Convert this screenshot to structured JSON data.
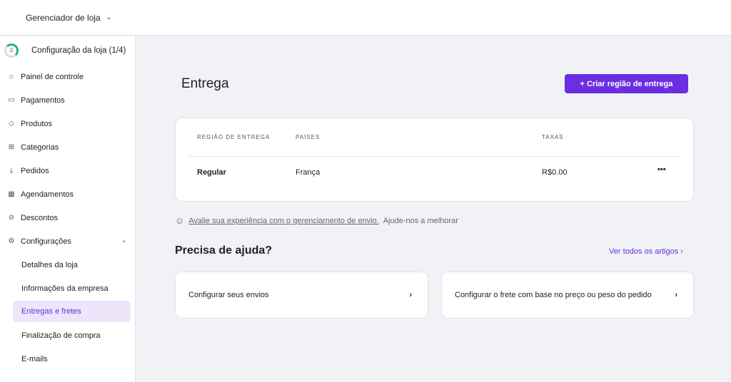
{
  "header": {
    "store_label": "Gerenciador de loja"
  },
  "sidebar": {
    "setup": "Configuração da loja (1/4)",
    "items": [
      {
        "label": "Painel de controle",
        "icon": "⌂"
      },
      {
        "label": "Pagamentos",
        "icon": "▭"
      },
      {
        "label": "Produtos",
        "icon": "◇"
      },
      {
        "label": "Categorias",
        "icon": "⊞"
      },
      {
        "label": "Pedidos",
        "icon": "⤓"
      },
      {
        "label": "Agendamentos",
        "icon": "▦"
      },
      {
        "label": "Descontos",
        "icon": "⊘"
      },
      {
        "label": "Configurações",
        "icon": "⚙"
      }
    ],
    "subitems": [
      "Detalhes da loja",
      "Informações da empresa",
      "Entregas e fretes",
      "Finalização de compra",
      "E-mails"
    ]
  },
  "main": {
    "title": "Entrega",
    "create_button": "+ Criar região de entrega",
    "table": {
      "headers": [
        "REGIÃO DE ENTREGA",
        "PAÍSES",
        "TAXAS"
      ],
      "rows": [
        {
          "region": "Regular",
          "countries": "França",
          "fees": "R$0.00"
        }
      ]
    },
    "feedback_link": "Avalie sua experiência com o gerenciamento de envio.",
    "feedback_text": "Ajude-nos a melhorar",
    "help_title": "Precisa de ajuda?",
    "all_articles": "Ver todos os artigos",
    "help_cards": [
      "Configurar seus envios",
      "Configurar o frete com base no preço ou peso do pedido"
    ]
  }
}
